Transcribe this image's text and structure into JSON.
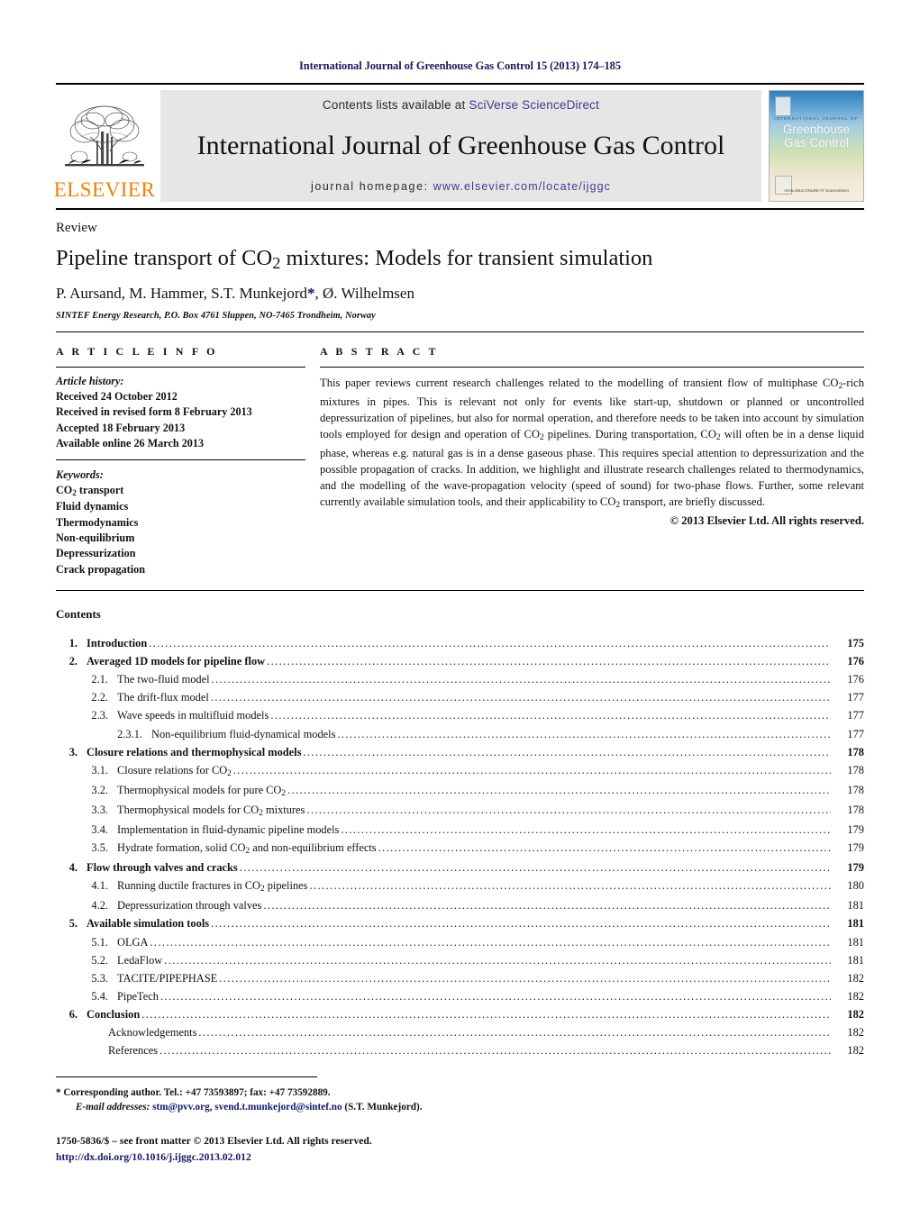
{
  "running_head": "International Journal of Greenhouse Gas Control 15 (2013) 174–185",
  "masthead": {
    "publisher_name": "ELSEVIER",
    "contents_prefix": "Contents lists available at ",
    "sciencedirect_link": "SciVerse ScienceDirect",
    "journal_title": "International Journal of Greenhouse Gas Control",
    "homepage_prefix": "journal homepage: ",
    "homepage_url": "www.elsevier.com/locate/ijggc",
    "cover": {
      "superline": "INTERNATIONAL JOURNAL OF",
      "title_line1": "Greenhouse",
      "title_line2": "Gas Control",
      "footer_text": "AVAILABLE ONLINE AT\nScienceDirect"
    },
    "band_color": "#e6e6e6",
    "link_color": "#3b3b8f",
    "elsevier_orange": "#F08000"
  },
  "article": {
    "type": "Review",
    "title_part1": "Pipeline transport of CO",
    "title_sub": "2",
    "title_part2": " mixtures: Models for transient simulation",
    "authors": "P. Aursand, M. Hammer, S.T. Munkejord",
    "authors_star": "*",
    "authors_tail": ", Ø. Wilhelmsen",
    "affiliation": "SINTEF Energy Research, P.O. Box 4761 Sluppen, NO-7465 Trondheim, Norway"
  },
  "info": {
    "heading": "A R T I C L E    I N F O",
    "history_label": "Article history:",
    "history": [
      "Received 24 October 2012",
      "Received in revised form 8 February 2013",
      "Accepted 18 February 2013",
      "Available online 26 March 2013"
    ],
    "keywords_label": "Keywords:",
    "keywords_first_pre": "CO",
    "keywords_first_sub": "2",
    "keywords_first_post": " transport",
    "keywords": [
      "Fluid dynamics",
      "Thermodynamics",
      "Non-equilibrium",
      "Depressurization",
      "Crack propagation"
    ]
  },
  "abstract": {
    "heading": "A B S T R A C T",
    "p1_a": "This paper reviews current research challenges related to the modelling of transient flow of multiphase CO",
    "p1_sub1": "2",
    "p1_b": "-rich mixtures in pipes. This is relevant not only for events like start-up, shutdown or planned or uncontrolled depressurization of pipelines, but also for normal operation, and therefore needs to be taken into account by simulation tools employed for design and operation of CO",
    "p1_sub2": "2",
    "p1_c": " pipelines. During transportation, CO",
    "p1_sub3": "2",
    "p1_d": " will often be in a dense liquid phase, whereas e.g. natural gas is in a dense gaseous phase. This requires special attention to depressurization and the possible propagation of cracks. In addition, we highlight and illustrate research challenges related to thermodynamics, and the modelling of the wave-propagation velocity (speed of sound) for two-phase flows. Further, some relevant currently available simulation tools, and their applicability to CO",
    "p1_sub4": "2",
    "p1_e": " transport, are briefly discussed.",
    "copyright": "© 2013 Elsevier Ltd. All rights reserved."
  },
  "contents": {
    "title": "Contents",
    "entries": [
      {
        "level": 1,
        "num": "1.",
        "label": "Introduction",
        "page": "175"
      },
      {
        "level": 1,
        "num": "2.",
        "label": "Averaged 1D models for pipeline flow",
        "page": "176"
      },
      {
        "level": 2,
        "num": "2.1.",
        "label": "The two-fluid model",
        "page": "176"
      },
      {
        "level": 2,
        "num": "2.2.",
        "label": "The drift-flux model",
        "page": "177"
      },
      {
        "level": 2,
        "num": "2.3.",
        "label": "Wave speeds in multifluid models",
        "page": "177"
      },
      {
        "level": 3,
        "num": "2.3.1.",
        "label": "Non-equilibrium fluid-dynamical models",
        "page": "177"
      },
      {
        "level": 1,
        "num": "3.",
        "label": "Closure relations and thermophysical models",
        "page": "178"
      },
      {
        "level": 2,
        "num": "3.1.",
        "label": "Closure relations for CO₂",
        "page": "178",
        "sub_pre": "Closure relations for CO",
        "sub": "2",
        "sub_post": ""
      },
      {
        "level": 2,
        "num": "3.2.",
        "label": "Thermophysical models for pure CO₂",
        "page": "178",
        "sub_pre": "Thermophysical models for pure CO",
        "sub": "2",
        "sub_post": ""
      },
      {
        "level": 2,
        "num": "3.3.",
        "label": "Thermophysical models for CO₂ mixtures",
        "page": "178",
        "sub_pre": "Thermophysical models for CO",
        "sub": "2",
        "sub_post": " mixtures"
      },
      {
        "level": 2,
        "num": "3.4.",
        "label": "Implementation in fluid-dynamic pipeline models",
        "page": "179"
      },
      {
        "level": 2,
        "num": "3.5.",
        "label": "Hydrate formation, solid CO₂ and non-equilibrium effects",
        "page": "179",
        "sub_pre": "Hydrate formation, solid CO",
        "sub": "2",
        "sub_post": " and non-equilibrium effects"
      },
      {
        "level": 1,
        "num": "4.",
        "label": "Flow through valves and cracks",
        "page": "179"
      },
      {
        "level": 2,
        "num": "4.1.",
        "label": "Running ductile fractures in CO₂ pipelines",
        "page": "180",
        "sub_pre": "Running ductile fractures in CO",
        "sub": "2",
        "sub_post": " pipelines"
      },
      {
        "level": 2,
        "num": "4.2.",
        "label": "Depressurization through valves",
        "page": "181"
      },
      {
        "level": 1,
        "num": "5.",
        "label": "Available simulation tools",
        "page": "181"
      },
      {
        "level": 2,
        "num": "5.1.",
        "label": "OLGA",
        "page": "181"
      },
      {
        "level": 2,
        "num": "5.2.",
        "label": "LedaFlow",
        "page": "181"
      },
      {
        "level": 2,
        "num": "5.3.",
        "label": "TACITE/PIPEPHASE",
        "page": "182"
      },
      {
        "level": 2,
        "num": "5.4.",
        "label": "PipeTech",
        "page": "182"
      },
      {
        "level": 1,
        "num": "6.",
        "label": "Conclusion",
        "page": "182"
      },
      {
        "level": 0,
        "num": "",
        "label": "Acknowledgements",
        "page": "182"
      },
      {
        "level": 0,
        "num": "",
        "label": "References",
        "page": "182"
      }
    ]
  },
  "footer": {
    "corresponding": "* Corresponding author. Tel.: +47 73593897; fax: +47 73592889.",
    "email_label": "E-mail addresses:",
    "email1": "stm@pvv.org",
    "email_sep": ", ",
    "email2": "svend.t.munkejord@sintef.no",
    "email_tail": " (S.T. Munkejord).",
    "issn_line": "1750-5836/$ – see front matter © 2013 Elsevier Ltd. All rights reserved.",
    "doi_line": "http://dx.doi.org/10.1016/j.ijggc.2013.02.012",
    "link_color": "#16166e"
  }
}
